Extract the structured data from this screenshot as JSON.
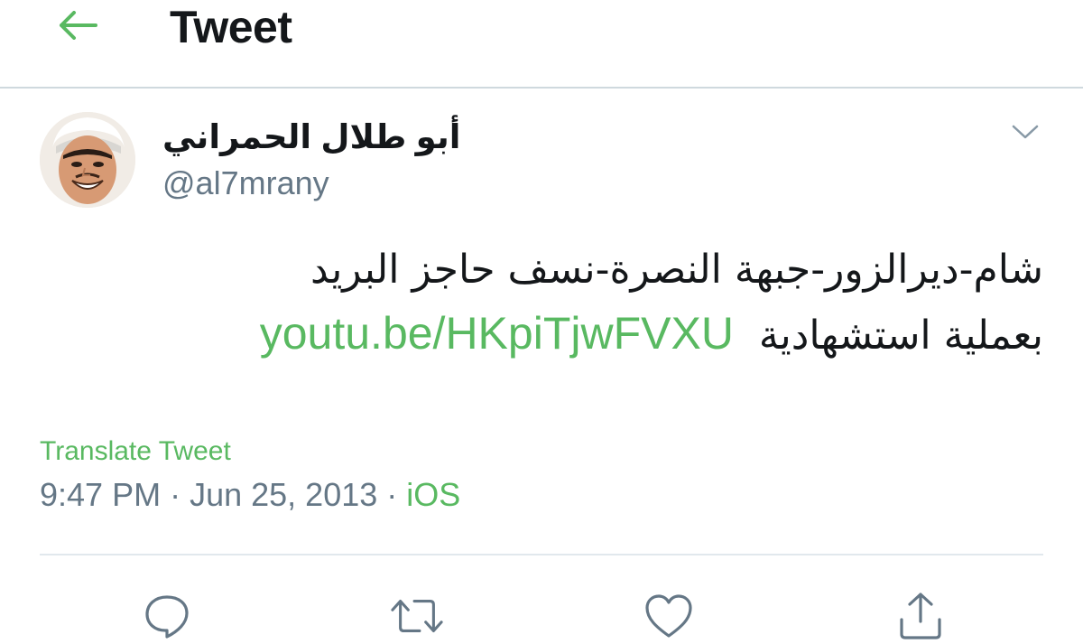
{
  "header": {
    "title": "Tweet",
    "back_icon": "arrow-left-icon",
    "accent_color": "#59b961"
  },
  "author": {
    "display_name": "أبو طلال الحمراني",
    "handle": "@al7mrany",
    "avatar_icon": "avatar"
  },
  "tweet": {
    "line1": "شام-ديرالزور-جبهة النصرة-نسف حاجز البريد",
    "line2_text": "بعملية استشهادية",
    "link": "youtu.be/HKpiTjwFVXU",
    "translate_label": "Translate Tweet",
    "time": "9:47 PM",
    "date": "Jun 25, 2013",
    "separator": "·",
    "source": "iOS"
  },
  "actions": [
    {
      "icon": "reply-icon"
    },
    {
      "icon": "retweet-icon"
    },
    {
      "icon": "like-icon"
    },
    {
      "icon": "share-icon"
    }
  ],
  "colors": {
    "text": "#14171a",
    "secondary": "#657786",
    "link": "#59b961",
    "divider": "#e1e8ed"
  }
}
